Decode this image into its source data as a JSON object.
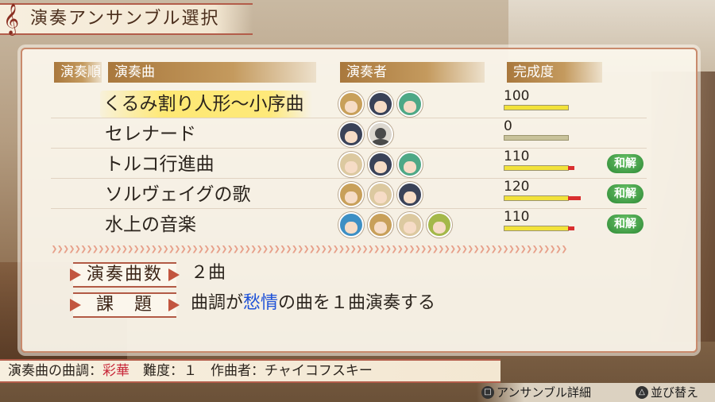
{
  "title": "演奏アンサンブル選択",
  "headers": {
    "order": "演奏順",
    "song": "演奏曲",
    "performers": "演奏者",
    "completion": "完成度"
  },
  "songs": [
    {
      "name": "くるみ割り人形～小序曲",
      "completion": "100",
      "fill": 1.0,
      "over": 0,
      "badge": "",
      "selected": true,
      "performers": [
        {
          "hair": "#c8a05a"
        },
        {
          "hair": "#3a4258"
        },
        {
          "hair": "#4ea886"
        }
      ]
    },
    {
      "name": "セレナード",
      "completion": "0",
      "fill": 0,
      "over": 0,
      "badge": "",
      "selected": false,
      "performers": [
        {
          "hair": "#3a4258"
        },
        {
          "empty": true
        }
      ]
    },
    {
      "name": "トルコ行進曲",
      "completion": "110",
      "fill": 1.0,
      "over": 0.1,
      "badge": "和解",
      "selected": false,
      "performers": [
        {
          "hair": "#dcc9a0"
        },
        {
          "hair": "#3a4258"
        },
        {
          "hair": "#4ea886"
        }
      ]
    },
    {
      "name": "ソルヴェイグの歌",
      "completion": "120",
      "fill": 1.0,
      "over": 0.2,
      "badge": "和解",
      "selected": false,
      "performers": [
        {
          "hair": "#c8a05a"
        },
        {
          "hair": "#dcc9a0"
        },
        {
          "hair": "#3a4258"
        }
      ]
    },
    {
      "name": "水上の音楽",
      "completion": "110",
      "fill": 1.0,
      "over": 0.1,
      "badge": "和解",
      "selected": false,
      "performers": [
        {
          "hair": "#3d8fc4"
        },
        {
          "hair": "#c8a05a"
        },
        {
          "hair": "#dcc9a0"
        },
        {
          "hair": "#a4b84a"
        }
      ]
    }
  ],
  "count": {
    "label": "演奏曲数",
    "value": "２曲"
  },
  "task": {
    "label": "課　題",
    "prefix": "曲調が",
    "keyword": "愁情",
    "suffix": "の曲を１曲演奏する"
  },
  "footer": {
    "mood_label": "演奏曲の曲調：",
    "mood": "彩華",
    "difficulty": "　難度：１　作曲者：チャイコフスキー"
  },
  "hints": {
    "detail": "アンサンブル詳細",
    "sort": "並び替え"
  },
  "colors": {
    "accent": "#b35d4a",
    "highlight": "#ffe86e",
    "badge": "#2d8a35",
    "keyword": "#1f52d8",
    "mood": "#c8283a"
  }
}
